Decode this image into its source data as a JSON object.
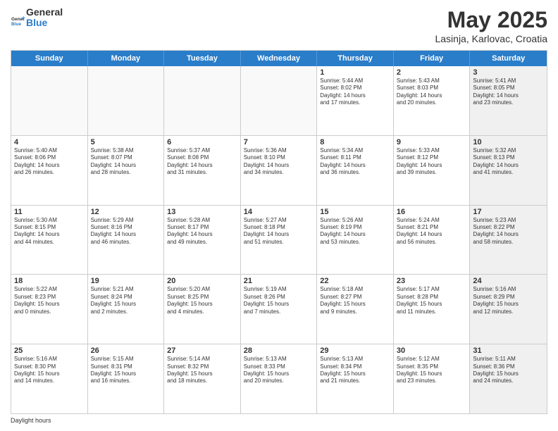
{
  "header": {
    "logo_general": "General",
    "logo_blue": "Blue",
    "title": "May 2025",
    "subtitle": "Lasinja, Karlovac, Croatia"
  },
  "day_names": [
    "Sunday",
    "Monday",
    "Tuesday",
    "Wednesday",
    "Thursday",
    "Friday",
    "Saturday"
  ],
  "weeks": [
    [
      {
        "day": "",
        "text": "",
        "empty": true
      },
      {
        "day": "",
        "text": "",
        "empty": true
      },
      {
        "day": "",
        "text": "",
        "empty": true
      },
      {
        "day": "",
        "text": "",
        "empty": true
      },
      {
        "day": "1",
        "text": "Sunrise: 5:44 AM\nSunset: 8:02 PM\nDaylight: 14 hours\nand 17 minutes.",
        "empty": false
      },
      {
        "day": "2",
        "text": "Sunrise: 5:43 AM\nSunset: 8:03 PM\nDaylight: 14 hours\nand 20 minutes.",
        "empty": false
      },
      {
        "day": "3",
        "text": "Sunrise: 5:41 AM\nSunset: 8:05 PM\nDaylight: 14 hours\nand 23 minutes.",
        "empty": false,
        "shaded": true
      }
    ],
    [
      {
        "day": "4",
        "text": "Sunrise: 5:40 AM\nSunset: 8:06 PM\nDaylight: 14 hours\nand 26 minutes.",
        "empty": false
      },
      {
        "day": "5",
        "text": "Sunrise: 5:38 AM\nSunset: 8:07 PM\nDaylight: 14 hours\nand 28 minutes.",
        "empty": false
      },
      {
        "day": "6",
        "text": "Sunrise: 5:37 AM\nSunset: 8:08 PM\nDaylight: 14 hours\nand 31 minutes.",
        "empty": false
      },
      {
        "day": "7",
        "text": "Sunrise: 5:36 AM\nSunset: 8:10 PM\nDaylight: 14 hours\nand 34 minutes.",
        "empty": false
      },
      {
        "day": "8",
        "text": "Sunrise: 5:34 AM\nSunset: 8:11 PM\nDaylight: 14 hours\nand 36 minutes.",
        "empty": false
      },
      {
        "day": "9",
        "text": "Sunrise: 5:33 AM\nSunset: 8:12 PM\nDaylight: 14 hours\nand 39 minutes.",
        "empty": false
      },
      {
        "day": "10",
        "text": "Sunrise: 5:32 AM\nSunset: 8:13 PM\nDaylight: 14 hours\nand 41 minutes.",
        "empty": false,
        "shaded": true
      }
    ],
    [
      {
        "day": "11",
        "text": "Sunrise: 5:30 AM\nSunset: 8:15 PM\nDaylight: 14 hours\nand 44 minutes.",
        "empty": false
      },
      {
        "day": "12",
        "text": "Sunrise: 5:29 AM\nSunset: 8:16 PM\nDaylight: 14 hours\nand 46 minutes.",
        "empty": false
      },
      {
        "day": "13",
        "text": "Sunrise: 5:28 AM\nSunset: 8:17 PM\nDaylight: 14 hours\nand 49 minutes.",
        "empty": false
      },
      {
        "day": "14",
        "text": "Sunrise: 5:27 AM\nSunset: 8:18 PM\nDaylight: 14 hours\nand 51 minutes.",
        "empty": false
      },
      {
        "day": "15",
        "text": "Sunrise: 5:26 AM\nSunset: 8:19 PM\nDaylight: 14 hours\nand 53 minutes.",
        "empty": false
      },
      {
        "day": "16",
        "text": "Sunrise: 5:24 AM\nSunset: 8:21 PM\nDaylight: 14 hours\nand 56 minutes.",
        "empty": false
      },
      {
        "day": "17",
        "text": "Sunrise: 5:23 AM\nSunset: 8:22 PM\nDaylight: 14 hours\nand 58 minutes.",
        "empty": false,
        "shaded": true
      }
    ],
    [
      {
        "day": "18",
        "text": "Sunrise: 5:22 AM\nSunset: 8:23 PM\nDaylight: 15 hours\nand 0 minutes.",
        "empty": false
      },
      {
        "day": "19",
        "text": "Sunrise: 5:21 AM\nSunset: 8:24 PM\nDaylight: 15 hours\nand 2 minutes.",
        "empty": false
      },
      {
        "day": "20",
        "text": "Sunrise: 5:20 AM\nSunset: 8:25 PM\nDaylight: 15 hours\nand 4 minutes.",
        "empty": false
      },
      {
        "day": "21",
        "text": "Sunrise: 5:19 AM\nSunset: 8:26 PM\nDaylight: 15 hours\nand 7 minutes.",
        "empty": false
      },
      {
        "day": "22",
        "text": "Sunrise: 5:18 AM\nSunset: 8:27 PM\nDaylight: 15 hours\nand 9 minutes.",
        "empty": false
      },
      {
        "day": "23",
        "text": "Sunrise: 5:17 AM\nSunset: 8:28 PM\nDaylight: 15 hours\nand 11 minutes.",
        "empty": false
      },
      {
        "day": "24",
        "text": "Sunrise: 5:16 AM\nSunset: 8:29 PM\nDaylight: 15 hours\nand 12 minutes.",
        "empty": false,
        "shaded": true
      }
    ],
    [
      {
        "day": "25",
        "text": "Sunrise: 5:16 AM\nSunset: 8:30 PM\nDaylight: 15 hours\nand 14 minutes.",
        "empty": false
      },
      {
        "day": "26",
        "text": "Sunrise: 5:15 AM\nSunset: 8:31 PM\nDaylight: 15 hours\nand 16 minutes.",
        "empty": false
      },
      {
        "day": "27",
        "text": "Sunrise: 5:14 AM\nSunset: 8:32 PM\nDaylight: 15 hours\nand 18 minutes.",
        "empty": false
      },
      {
        "day": "28",
        "text": "Sunrise: 5:13 AM\nSunset: 8:33 PM\nDaylight: 15 hours\nand 20 minutes.",
        "empty": false
      },
      {
        "day": "29",
        "text": "Sunrise: 5:13 AM\nSunset: 8:34 PM\nDaylight: 15 hours\nand 21 minutes.",
        "empty": false
      },
      {
        "day": "30",
        "text": "Sunrise: 5:12 AM\nSunset: 8:35 PM\nDaylight: 15 hours\nand 23 minutes.",
        "empty": false
      },
      {
        "day": "31",
        "text": "Sunrise: 5:11 AM\nSunset: 8:36 PM\nDaylight: 15 hours\nand 24 minutes.",
        "empty": false,
        "shaded": true
      }
    ]
  ],
  "footer": {
    "daylight_label": "Daylight hours"
  }
}
